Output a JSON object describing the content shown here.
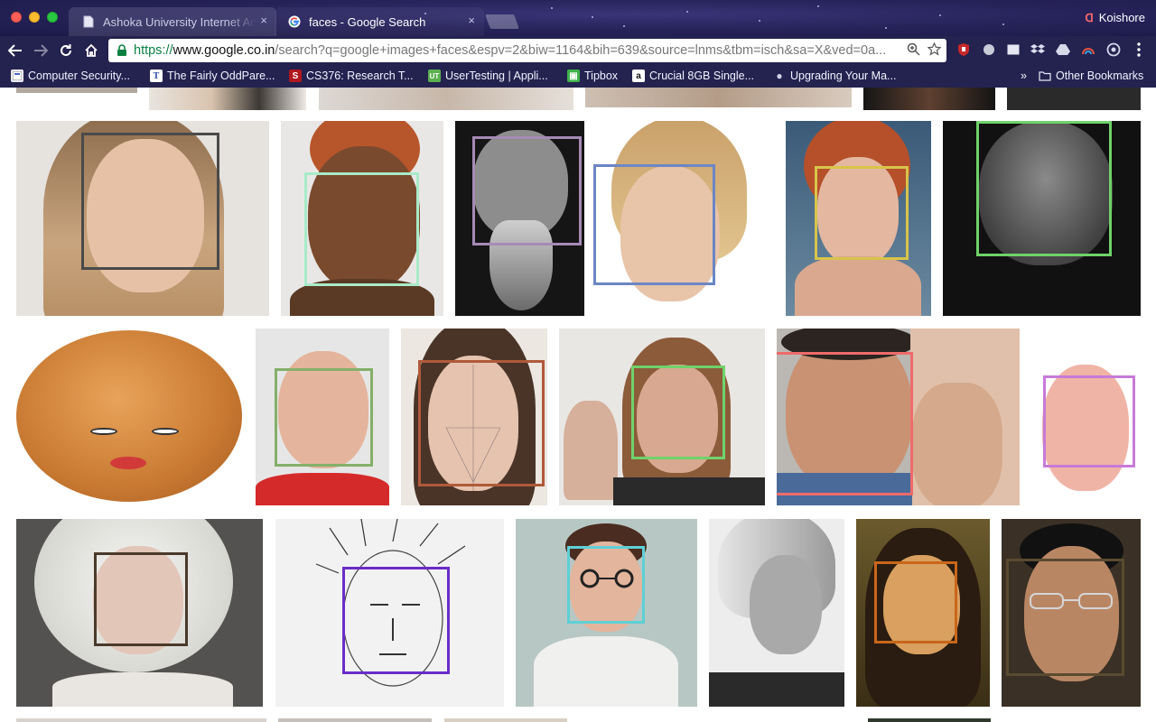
{
  "window": {
    "tabs": [
      {
        "title": "Ashoka University Internet Acc",
        "active": false,
        "icon": "page-icon"
      },
      {
        "title": "faces - Google Search",
        "active": true,
        "icon": "google-g-icon"
      }
    ],
    "close_glyph": "×",
    "profile_name": "Koishore"
  },
  "toolbar": {
    "url_scheme": "https://",
    "url_host": "www.google.co.in",
    "url_rest": "/search?q=google+images+faces&espv=2&biw=1164&bih=639&source=lnms&tbm=isch&sa=X&ved=0a..."
  },
  "bookmarks": [
    {
      "label": "Computer Security...",
      "icon": "page-icon"
    },
    {
      "label": "The Fairly OddPare...",
      "icon": "tvtropes-icon"
    },
    {
      "label": "CS376: Research T...",
      "icon": "stanford-icon"
    },
    {
      "label": "UserTesting | Appli...",
      "icon": "usertesting-icon"
    },
    {
      "label": "Tipbox",
      "icon": "tipbox-icon"
    },
    {
      "label": "Crucial 8GB Single...",
      "icon": "amazon-icon"
    },
    {
      "label": "Upgrading Your Ma...",
      "icon": "apple-icon"
    }
  ],
  "bookmarks_overflow": "»",
  "other_bookmarks": "Other Bookmarks",
  "colors": {
    "frame": "#24224f",
    "box_dark_gray": "#4a4a4a",
    "box_mint": "#a8ebc8",
    "box_lilac": "#a68ab5",
    "box_blue": "#6b86c4",
    "box_yellow": "#d8c44a",
    "box_green": "#6fd36a",
    "box_olive": "#84b06a",
    "box_rust": "#b05a3a",
    "box_salmon": "#ef6b6b",
    "box_violet": "#c77ad8",
    "box_brown": "#4a3a2a",
    "box_purple": "#6a2cc8",
    "box_cyan": "#5ed0d6",
    "box_orange": "#c9661a",
    "box_bronze": "#5a4a30"
  }
}
